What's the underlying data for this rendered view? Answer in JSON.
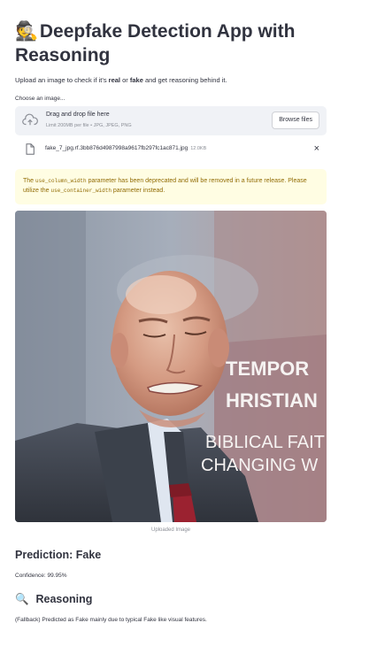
{
  "header": {
    "emoji": "🕵️",
    "title": "Deepfake Detection App with Reasoning"
  },
  "intro": {
    "prefix": "Upload an image to check if it's ",
    "real": "real",
    "or": " or ",
    "fake": "fake",
    "suffix": " and get reasoning behind it."
  },
  "uploader": {
    "label": "Choose an image...",
    "drag_text": "Drag and drop file here",
    "limit_text": "Limit 200MB per file • JPG, JPEG, PNG",
    "browse_label": "Browse files",
    "file_name": "fake_7_jpg.rf.3bb876d4987998a9617fb297fc1ac871.jpg",
    "file_size": "12.0KB",
    "close_glyph": "×"
  },
  "warning": {
    "part1": "The ",
    "code1": "use_column_width",
    "part2": " parameter has been deprecated and will be removed in a future release. Please utilize the ",
    "code2": "use_container_width",
    "part3": " parameter instead."
  },
  "image": {
    "caption": "Uploaded Image",
    "banner_lines": [
      "TEMPOR",
      "HRISTIAN",
      "BIBLICAL FAIT",
      "CHANGING W"
    ]
  },
  "result": {
    "prediction": "Prediction: Fake",
    "confidence": "Confidence: 99.95%"
  },
  "reasoning": {
    "emoji": "🔍",
    "heading": "Reasoning",
    "text": "(Fallback) Predicted as Fake mainly due to typical Fake like visual features."
  },
  "colors": {
    "text": "#31333f",
    "dropzone_bg": "#f0f2f6",
    "warning_bg": "#fffde3",
    "warning_text": "#926c05"
  }
}
